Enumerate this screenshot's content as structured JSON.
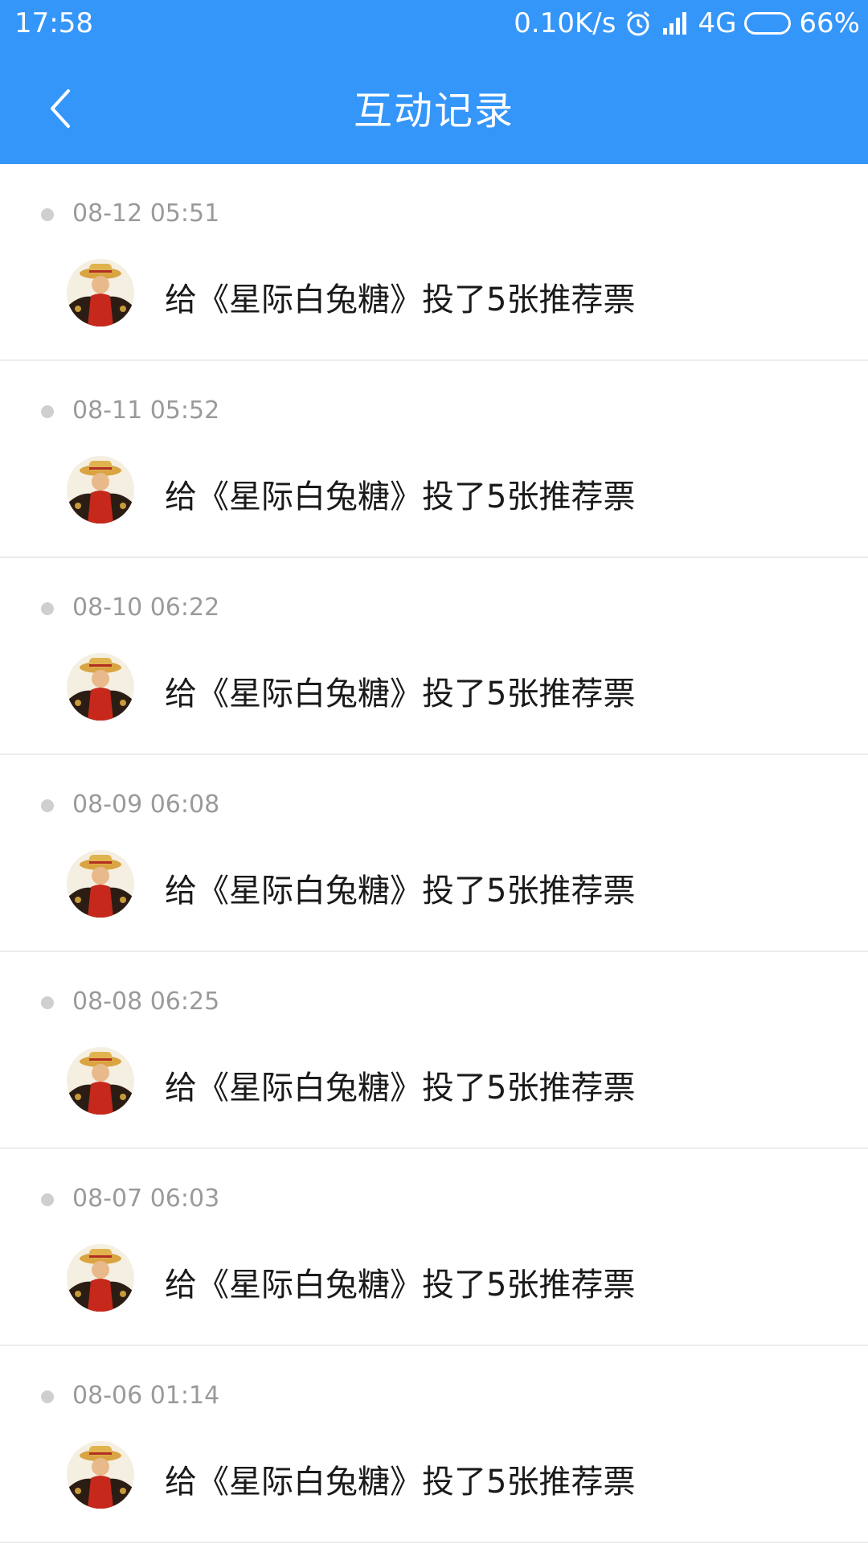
{
  "status_bar": {
    "time": "17:58",
    "net_speed": "0.10K/s",
    "network": "4G",
    "battery": "66%",
    "battery_level": 0.66
  },
  "header": {
    "title": "互动记录"
  },
  "records": [
    {
      "time": "08-12 05:51",
      "text": "给《星际白兔糖》投了5张推荐票"
    },
    {
      "time": "08-11 05:52",
      "text": "给《星际白兔糖》投了5张推荐票"
    },
    {
      "time": "08-10 06:22",
      "text": "给《星际白兔糖》投了5张推荐票"
    },
    {
      "time": "08-09 06:08",
      "text": "给《星际白兔糖》投了5张推荐票"
    },
    {
      "time": "08-08 06:25",
      "text": "给《星际白兔糖》投了5张推荐票"
    },
    {
      "time": "08-07 06:03",
      "text": "给《星际白兔糖》投了5张推荐票"
    },
    {
      "time": "08-06 01:14",
      "text": "给《星际白兔糖》投了5张推荐票"
    }
  ],
  "colors": {
    "primary": "#3596f9",
    "text": "#1a1a1a",
    "muted": "#9a9a9a"
  }
}
